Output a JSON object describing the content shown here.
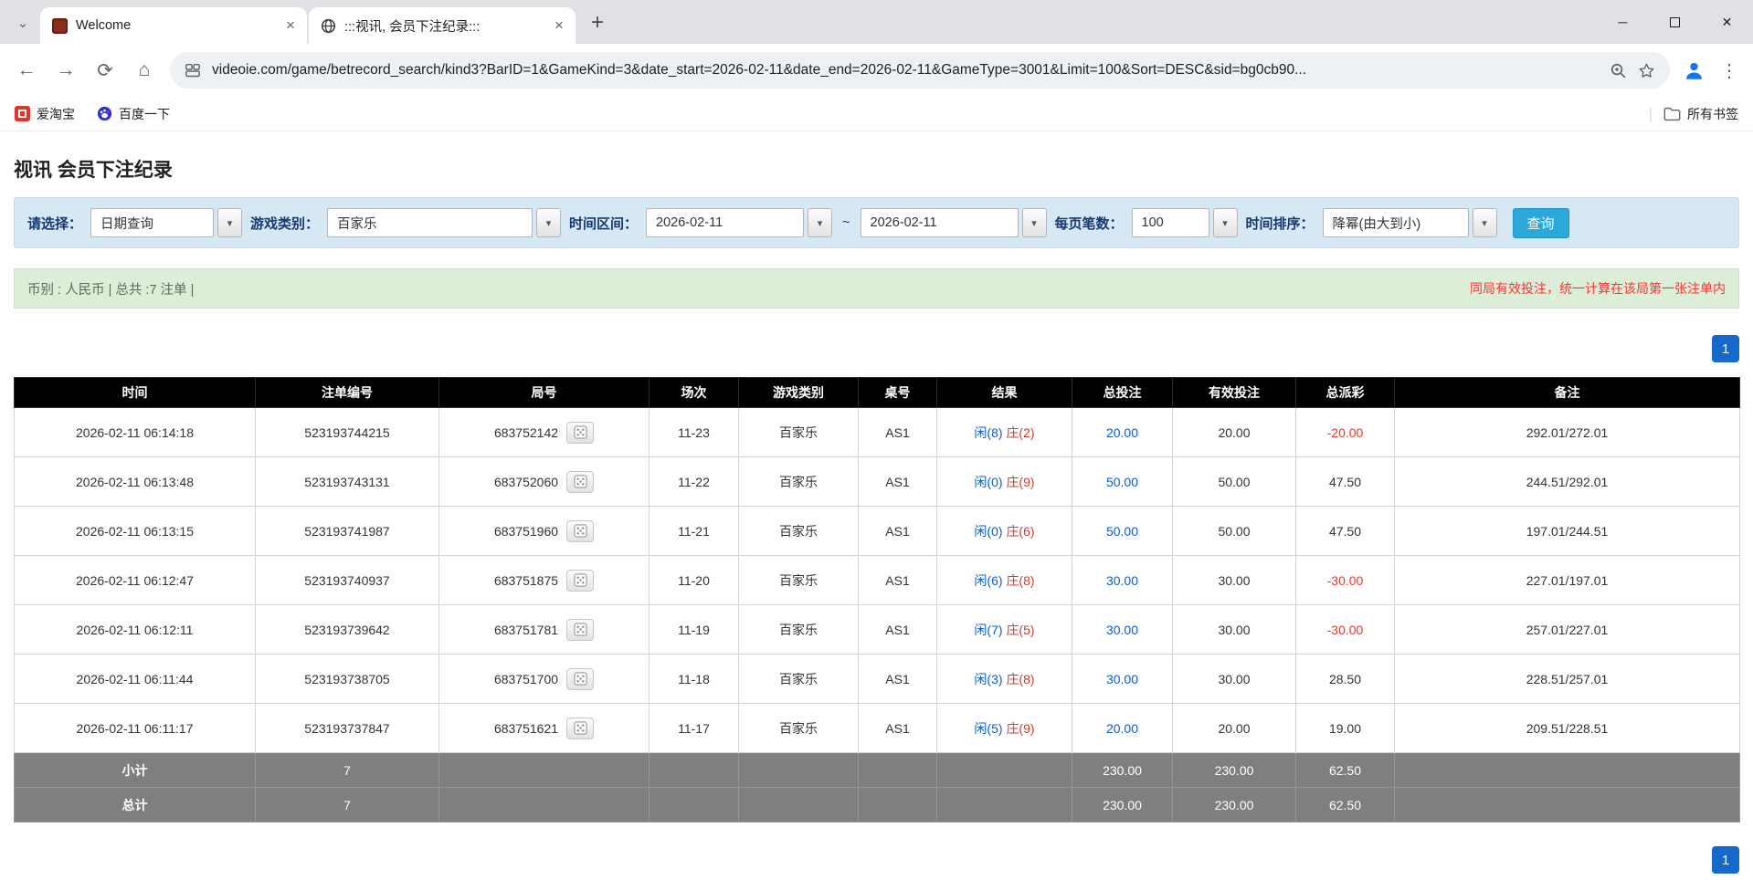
{
  "colors": {
    "accent_blue": "#1668c9",
    "bet_blue": "#0a5fd0",
    "loss_red": "#e8382f",
    "player_blue": "#0a5fd0",
    "banker_red": "#d43a2f",
    "search_button": "#2ba8d8",
    "filter_bg": "#d6e8f3",
    "info_bg": "#dcedd8",
    "notice_red": "#ff3333"
  },
  "icons": {
    "tab_search": "⌄",
    "tab_close": "×",
    "new_tab": "+",
    "minimize": "─",
    "close": "✕",
    "back": "←",
    "forward": "→",
    "reload": "⟳",
    "home": "⌂",
    "menu": "⋮",
    "dropdown_arrow": "▾",
    "bookmark_separator": "|"
  },
  "browser": {
    "tabs": [
      {
        "title": "Welcome"
      },
      {
        "title": ":::视讯, 会员下注纪录:::"
      }
    ],
    "url": "videoie.com/game/betrecord_search/kind3?BarID=1&GameKind=3&date_start=2026-02-11&date_end=2026-02-11&GameType=3001&Limit=100&Sort=DESC&sid=bg0cb90...",
    "bookmarks": [
      {
        "label": "爱淘宝"
      },
      {
        "label": "百度一下"
      }
    ],
    "all_bookmarks_label": "所有书签"
  },
  "page": {
    "title": "视讯 会员下注纪录",
    "filters": {
      "select_label": "请选择：",
      "select_value": "日期查询",
      "game_label": "游戏类别：",
      "game_value": "百家乐",
      "range_label": "时间区间：",
      "date_start": "2026-02-11",
      "range_separator": "~",
      "date_end": "2026-02-11",
      "per_page_label": "每页笔数：",
      "per_page_value": "100",
      "sort_label": "时间排序：",
      "sort_value": "降幂(由大到小)",
      "search_button": "查询"
    },
    "info": {
      "summary": "币别 : 人民币 | 总共 :7 注单 |",
      "notice": "同局有效投注，统一计算在该局第一张注单内"
    },
    "pagination": {
      "page": "1"
    }
  },
  "table": {
    "headers": [
      "时间",
      "注单编号",
      "局号",
      "场次",
      "游戏类别",
      "桌号",
      "结果",
      "总投注",
      "有效投注",
      "总派彩",
      "备注"
    ],
    "rows": [
      {
        "time": "2026-02-11 06:14:18",
        "bet_id": "523193744215",
        "round_id": "683752142",
        "session": "11-23",
        "game": "百家乐",
        "table_no": "AS1",
        "result_player": "闲(8)",
        "result_banker": "庄(2)",
        "total_bet": "20.00",
        "valid_bet": "20.00",
        "payout": "-20.00",
        "remark": "292.01/272.01"
      },
      {
        "time": "2026-02-11 06:13:48",
        "bet_id": "523193743131",
        "round_id": "683752060",
        "session": "11-22",
        "game": "百家乐",
        "table_no": "AS1",
        "result_player": "闲(0)",
        "result_banker": "庄(9)",
        "total_bet": "50.00",
        "valid_bet": "50.00",
        "payout": "47.50",
        "remark": "244.51/292.01"
      },
      {
        "time": "2026-02-11 06:13:15",
        "bet_id": "523193741987",
        "round_id": "683751960",
        "session": "11-21",
        "game": "百家乐",
        "table_no": "AS1",
        "result_player": "闲(0)",
        "result_banker": "庄(6)",
        "total_bet": "50.00",
        "valid_bet": "50.00",
        "payout": "47.50",
        "remark": "197.01/244.51"
      },
      {
        "time": "2026-02-11 06:12:47",
        "bet_id": "523193740937",
        "round_id": "683751875",
        "session": "11-20",
        "game": "百家乐",
        "table_no": "AS1",
        "result_player": "闲(6)",
        "result_banker": "庄(8)",
        "total_bet": "30.00",
        "valid_bet": "30.00",
        "payout": "-30.00",
        "remark": "227.01/197.01"
      },
      {
        "time": "2026-02-11 06:12:11",
        "bet_id": "523193739642",
        "round_id": "683751781",
        "session": "11-19",
        "game": "百家乐",
        "table_no": "AS1",
        "result_player": "闲(7)",
        "result_banker": "庄(5)",
        "total_bet": "30.00",
        "valid_bet": "30.00",
        "payout": "-30.00",
        "remark": "257.01/227.01"
      },
      {
        "time": "2026-02-11 06:11:44",
        "bet_id": "523193738705",
        "round_id": "683751700",
        "session": "11-18",
        "game": "百家乐",
        "table_no": "AS1",
        "result_player": "闲(3)",
        "result_banker": "庄(8)",
        "total_bet": "30.00",
        "valid_bet": "30.00",
        "payout": "28.50",
        "remark": "228.51/257.01"
      },
      {
        "time": "2026-02-11 06:11:17",
        "bet_id": "523193737847",
        "round_id": "683751621",
        "session": "11-17",
        "game": "百家乐",
        "table_no": "AS1",
        "result_player": "闲(5)",
        "result_banker": "庄(9)",
        "total_bet": "20.00",
        "valid_bet": "20.00",
        "payout": "19.00",
        "remark": "209.51/228.51"
      }
    ],
    "subtotal": {
      "label": "小计",
      "count": "7",
      "total_bet": "230.00",
      "valid_bet": "230.00",
      "payout": "62.50"
    },
    "total": {
      "label": "总计",
      "count": "7",
      "total_bet": "230.00",
      "valid_bet": "230.00",
      "payout": "62.50"
    }
  }
}
